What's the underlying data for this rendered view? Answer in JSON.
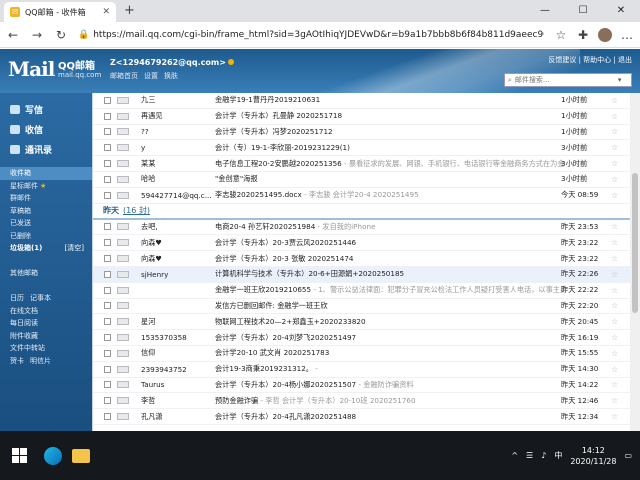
{
  "browser": {
    "tab_title": "QQ邮箱 - 收件箱",
    "tab_close": "✕",
    "new_tab": "+",
    "url": "https://mail.qq.com/cgi-bin/frame_html?sid=3gAOtIhiqYJDEVwD&r=b9a1b7bbb8b6f84b811d9aeec9084940",
    "back": "←",
    "forward": "→",
    "refresh": "↻",
    "window_min": "—",
    "window_max": "☐",
    "window_close": "✕"
  },
  "header": {
    "logo": "Mail",
    "logo_cn": "QQ邮箱",
    "logo_sub": "mail.qq.com",
    "user": "Z<1294679262@qq.com>",
    "links": [
      "邮箱首页",
      "设置",
      "换肤"
    ],
    "top_links": "反馈建议 | 帮助中心 | 退出",
    "search_placeholder": "邮件搜索..."
  },
  "sidebar": {
    "write": "写信",
    "inbox": "收信",
    "contacts": "通讯录",
    "items": [
      "收件箱",
      "星标邮件",
      "群邮件",
      "草稿箱",
      "已发送",
      "已删除"
    ],
    "trash": "垃圾箱(1)",
    "clear": "[清空]",
    "other": "其他邮箱",
    "calendar": "日历",
    "notes": "记事本",
    "docs": "在线文档",
    "daily": "每日阅读",
    "attachments": "附件收藏",
    "transfer": "文件中转站",
    "cards": "贺卡",
    "postcard": "明信片"
  },
  "mail_list": {
    "group_yesterday": "昨天",
    "group_yesterday_count": "(16 封)",
    "top_rows": [
      {
        "from": "九三",
        "subject": "金融学19-1曹丹丹2019210631",
        "preview": "",
        "time": "1小时前"
      },
      {
        "from": "再遇见",
        "subject": "会计学（专升本）孔曼静 2020251718",
        "preview": "",
        "time": "1小时前"
      },
      {
        "from": "??",
        "subject": "会计学（专升本）冯梦2020251712",
        "preview": "",
        "time": "1小时前"
      },
      {
        "from": "y",
        "subject": "会计（专）19-1-李欣丽-2019231229(1)",
        "preview": "",
        "time": "3小时前"
      },
      {
        "from": "某某",
        "subject": "电子信息工程20-2安鹏越2020251356",
        "preview": " - 暴看征求的发展、网银、手机银行、电话银行等金融商务方式在为金融消费者带来最大...",
        "time": "3小时前"
      },
      {
        "from": "哈哈",
        "subject": "\"金创意\"海报",
        "preview": "",
        "time": "3小时前"
      },
      {
        "from": "594427714@qq.c...",
        "subject": "李志骏2020251495.docx",
        "preview": " - 李志骏 会计学20-4 2020251495",
        "time": "今天 08:59"
      }
    ],
    "yesterday_rows": [
      {
        "from": "去吧,",
        "subject": "电商20-4 孙艺轩2020251984",
        "preview": " - 发自我的iPhone",
        "time": "昨天 23:53"
      },
      {
        "from": "向森♥",
        "subject": "会计学（专升本）20-3贾云风2020251446",
        "preview": "",
        "time": "昨天 23:22"
      },
      {
        "from": "向森♥",
        "subject": "会计学（专升本）20-3 张敏 2020251474",
        "preview": "",
        "time": "昨天 23:22"
      },
      {
        "from": "sjHenry",
        "subject": "计算机科学与技术（专升本）20-6+田源娟+2020250185",
        "preview": "",
        "time": "昨天 22:26"
      },
      {
        "from": "",
        "subject": "金融学一班王欣2019210655",
        "preview": " - 1、警示公益法律面：犯罪分子冒充公检法工作人员疑打受害人电话，以事主身份信息被盗用涉嫌...",
        "time": "昨天 22:22"
      },
      {
        "from": "",
        "subject": "发信方已删回邮件: 金融学一班王欣",
        "preview": "",
        "time": "昨天 22:20"
      },
      {
        "from": "星河",
        "subject": "物联网工程技术20—2+郑鑫玉+2020233820",
        "preview": "",
        "time": "昨天 20:45"
      },
      {
        "from": "1535370358",
        "subject": "会计学（专升本）20-4刘梦飞2020251497",
        "preview": "",
        "time": "昨天 16:19"
      },
      {
        "from": "信仰",
        "subject": "会计学20-10 武文肖 2020251783",
        "preview": "",
        "time": "昨天 15:55"
      },
      {
        "from": "2393943752",
        "subject": "会计19-3商秉2019231312。",
        "preview": " - ",
        "time": "昨天 14:30"
      },
      {
        "from": "Taurus",
        "subject": "会计学（专升本）20-4杨小娜2020251507",
        "preview": " - 金融防诈骗资料",
        "time": "昨天 14:22"
      },
      {
        "from": "李哲",
        "subject": "预防金融诈骗",
        "preview": " - 李哲 会计学（专升本）20-10班 2020251760",
        "time": "昨天 12:46"
      },
      {
        "from": "孔凡潇",
        "subject": "会计学（专升本）20-4孔凡潇2020251488",
        "preview": "",
        "time": "昨天 12:34"
      }
    ]
  },
  "taskbar": {
    "time": "14:12",
    "date": "2020/11/28",
    "ime": "中"
  }
}
